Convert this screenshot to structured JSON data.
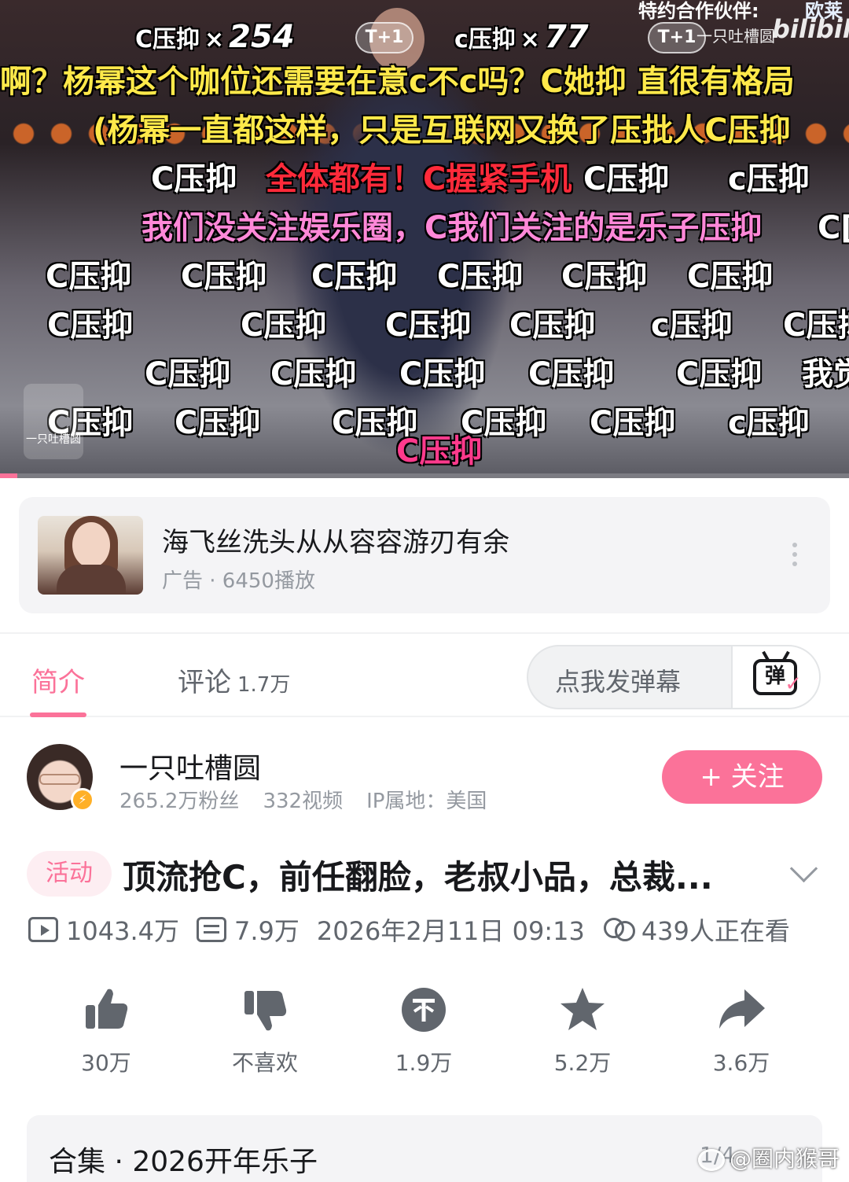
{
  "video": {
    "top_partial_text": "特约合作伙伴:",
    "top_partial_text_2": "欧莱",
    "combo_1": {
      "label": "C压抑",
      "mult": "×",
      "count": "254"
    },
    "combo_2": {
      "label": "c压抑",
      "mult": "×",
      "count": "77"
    },
    "badge": "T+1",
    "channel_watermark": "一只吐槽圆",
    "bilibili_logo": "bilibili",
    "left_logo_text": "一只吐槽圆",
    "progress_percent": 0.02,
    "danmaku": [
      {
        "text": "啊？杨幂这个咖位还需要在意c不c吗？C她抑 直很有格局",
        "color": "yellow"
      },
      {
        "text": "(杨幂一直都这样，只是互联网又换了压批人C压抑",
        "color": "yellow"
      },
      {
        "text": "C压抑",
        "color": "white"
      },
      {
        "text": "全体都有！C握紧手机",
        "color": "red"
      },
      {
        "text": "C压抑",
        "color": "white"
      },
      {
        "text": "c压抑",
        "color": "white"
      },
      {
        "text": "我们没关注娱乐圈，C我们关注的是乐子压抑",
        "color": "pink"
      },
      {
        "text": "C[",
        "color": "white"
      },
      {
        "text": "C压抑",
        "color": "white"
      },
      {
        "text": "C压抑",
        "color": "white"
      },
      {
        "text": "C压抑",
        "color": "white"
      },
      {
        "text": "C压抑",
        "color": "white"
      },
      {
        "text": "C压抑",
        "color": "white"
      },
      {
        "text": "C压抑",
        "color": "white"
      },
      {
        "text": "C压抑",
        "color": "white"
      },
      {
        "text": "C压抑",
        "color": "white"
      },
      {
        "text": "C压抑",
        "color": "white"
      },
      {
        "text": "C压抑",
        "color": "white"
      },
      {
        "text": "c压抑",
        "color": "white"
      },
      {
        "text": "C压抑",
        "color": "white"
      },
      {
        "text": "C压抑",
        "color": "white"
      },
      {
        "text": "C压抑",
        "color": "white"
      },
      {
        "text": "C压抑",
        "color": "white"
      },
      {
        "text": "C压抑",
        "color": "white"
      },
      {
        "text": "C压抑",
        "color": "white"
      },
      {
        "text": "我觉",
        "color": "white"
      },
      {
        "text": "C压抑",
        "color": "white"
      },
      {
        "text": "C压抑",
        "color": "white"
      },
      {
        "text": "C压抑",
        "color": "white"
      },
      {
        "text": "C压抑",
        "color": "white"
      },
      {
        "text": "C压抑",
        "color": "white"
      },
      {
        "text": "c压抑",
        "color": "white"
      },
      {
        "text": "C压抑",
        "color": "magenta"
      }
    ]
  },
  "ad": {
    "title": "海飞丝洗头从从容容游刃有余",
    "meta": "广告 · 6450播放"
  },
  "tabs": {
    "intro": "简介",
    "comments": "评论",
    "comments_count": "1.7万",
    "danmaku_placeholder": "点我发弹幕",
    "danmaku_button": "弹"
  },
  "uploader": {
    "name": "一只吐槽圆",
    "fans": "265.2万粉丝",
    "videos": "332视频",
    "ip": "IP属地：美国",
    "follow": "+ 关注"
  },
  "video_info": {
    "tag": "活动",
    "title": "顶流抢C，前任翻脸，老叔小品，总裁...",
    "views": "1043.4万",
    "danmaku_count": "7.9万",
    "date": "2026年2月11日 09:13",
    "watching": "439人正在看"
  },
  "actions": [
    {
      "name": "like",
      "label": "30万"
    },
    {
      "name": "dislike",
      "label": "不喜欢"
    },
    {
      "name": "coin",
      "label": "1.9万"
    },
    {
      "name": "favorite",
      "label": "5.2万"
    },
    {
      "name": "share",
      "label": "3.6万"
    }
  ],
  "collection": {
    "label": "合集 · 2026开年乐子",
    "progress": "1/4"
  },
  "watermark": "@圈内猴哥",
  "colors": {
    "accent": "#fb7299",
    "text_primary": "#18191c",
    "text_secondary": "#61666d",
    "text_muted": "#9499a0"
  }
}
